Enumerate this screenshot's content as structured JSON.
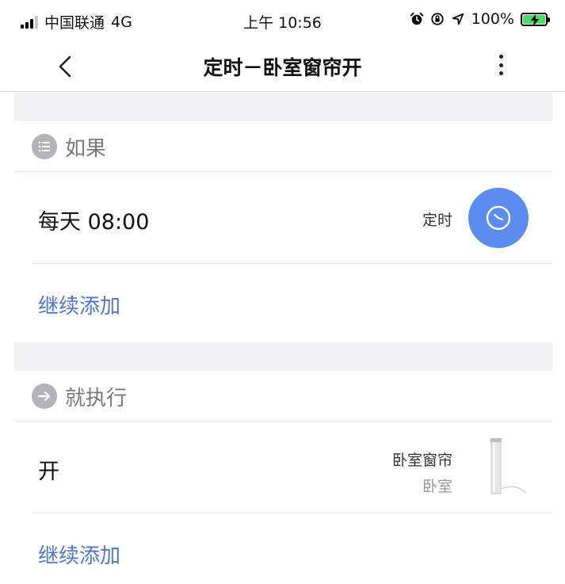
{
  "status_bar": {
    "carrier": "中国联通",
    "network": "4G",
    "time": "上午 10:56",
    "battery": "100%"
  },
  "nav": {
    "title": "定时－卧室窗帘开"
  },
  "condition_section": {
    "header": "如果",
    "items": [
      {
        "text": "每天 08:00",
        "type_label": "定时"
      }
    ],
    "add_label": "继续添加"
  },
  "action_section": {
    "header": "就执行",
    "items": [
      {
        "text": "开",
        "device_name": "卧室窗帘",
        "room": "卧室"
      }
    ],
    "add_label": "继续添加"
  },
  "colors": {
    "accent": "#4e77d4",
    "clock_badge": "#5b8cf0",
    "separator_band": "#f2f2f4"
  }
}
